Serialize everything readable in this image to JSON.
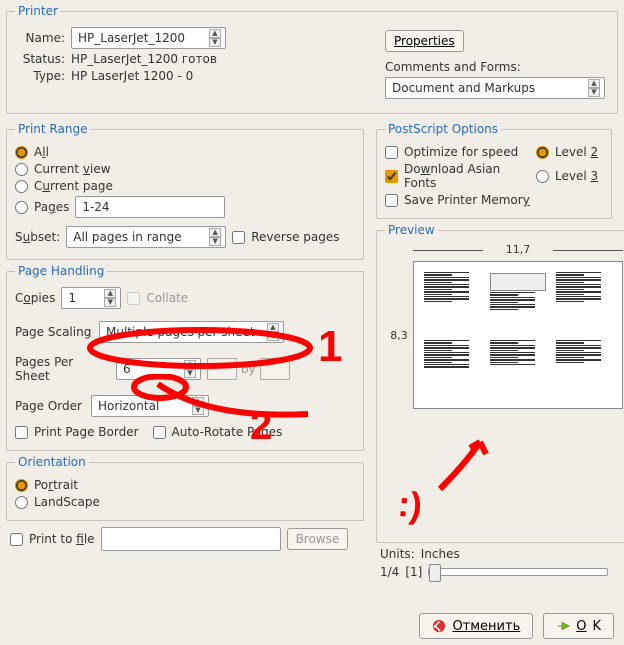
{
  "printer": {
    "legend": "Printer",
    "name_label": "Name:",
    "name_value": "HP_LaserJet_1200",
    "status_label": "Status:",
    "status_value": "HP_LaserJet_1200 готов",
    "type_label": "Type:",
    "type_value": "HP LaserJet 1200 -  0",
    "properties_btn": "Properties",
    "comments_label": "Comments and Forms:",
    "comments_value": "Document and Markups"
  },
  "range": {
    "legend": "Print Range",
    "all": "All",
    "current_view": "Current view",
    "current_page": "Current page",
    "pages": "Pages",
    "pages_value": "1-24",
    "subset_label": "Subset:",
    "subset_value": "All pages in range",
    "reverse": "Reverse pages"
  },
  "handling": {
    "legend": "Page Handling",
    "copies_label": "Copies",
    "copies_value": "1",
    "collate": "Collate",
    "scaling_label": "Page Scaling",
    "scaling_value": "Multiple pages per sheet",
    "pps_label": "Pages Per Sheet",
    "pps_value": "6",
    "by": "by",
    "order_label": "Page Order",
    "order_value": "Horizontal",
    "border": "Print Page Border",
    "autorotate": "Auto-Rotate Pages"
  },
  "orientation": {
    "legend": "Orientation",
    "portrait": "Portrait",
    "landscape": "LandScape"
  },
  "print_to_file": "Print to file",
  "browse": "Browse",
  "postscript": {
    "legend": "PostScript Options",
    "optimize": "Optimize for speed",
    "level2": "Level 2",
    "asian": "Download Asian Fonts",
    "level3": "Level 3",
    "memory": "Save Printer Memory"
  },
  "preview": {
    "legend": "Preview",
    "w": "11,7",
    "h": "8,3",
    "units_label": "Units:",
    "units_value": "Inches",
    "counter": "1/4",
    "counter2": "[1]"
  },
  "buttons": {
    "cancel": "Отменить",
    "ok": "OK"
  },
  "annot": {
    "n1": "1",
    "n2": "2",
    "smile": ":)"
  }
}
